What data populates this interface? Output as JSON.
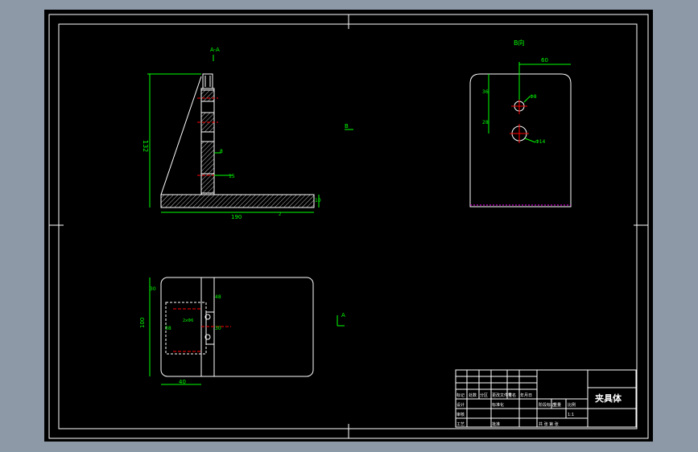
{
  "colors": {
    "viewport_bg": "#8d99a7",
    "sheet_bg": "#000000",
    "line": "#ffffff",
    "dimension": "#00ff00",
    "centerline": "#ff0000",
    "hatch": "#cccccc",
    "magenta": "#ff00ff",
    "title_text": "#ffffff"
  },
  "views": {
    "section_label": "A-A",
    "view_b_label": "B向",
    "marker_b": "B",
    "marker_a": "A"
  },
  "dimensions": {
    "height_total": "132",
    "base_length": "190",
    "rib_thickness": "8",
    "web_thickness": "15",
    "base_thickness": "10",
    "base_extra": "2",
    "b_offset": "60",
    "b_d1": "36",
    "b_d2": "28",
    "b_hole1": "Φ8",
    "b_hole2": "Φ14",
    "top_h1": "30",
    "top_total": "100",
    "top_h2": "38",
    "top_w": "40",
    "top_r": "48",
    "top_slot": "30",
    "top_hole": "2xΦ6"
  },
  "title_block": {
    "title": "夹具体",
    "labels": {
      "stage_mark": "阶段标记",
      "weight": "重量",
      "scale": "比例",
      "scale_value": "1:1",
      "sheet_of": "共  张  第  张",
      "design": "设计",
      "review": "审核",
      "process": "工艺",
      "approve": "批准",
      "mark": "标记",
      "count": "处数",
      "zone": "分区",
      "change_no": "更改文件号",
      "signature": "签名",
      "date": "年月日",
      "standard": "标准化"
    }
  }
}
